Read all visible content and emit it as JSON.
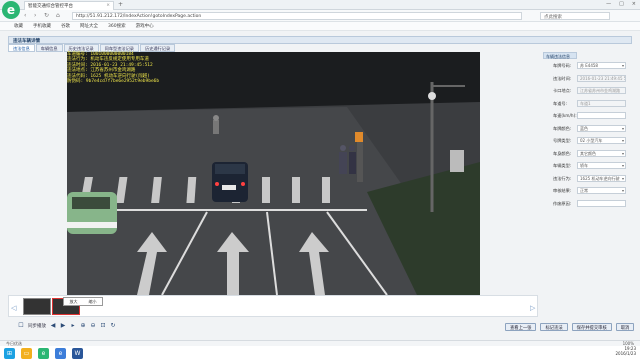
{
  "browser": {
    "tab_title": "智能交通综合管控平台",
    "url": "http://51.91.212.172/IndexAction!gotoIndexPage.action",
    "search_placeholder": "点此搜索",
    "favorites": [
      "收藏",
      "手机收藏",
      "谷歌",
      "网址大全",
      "360搜索",
      "游戏中心"
    ]
  },
  "panel": {
    "title": "违法车辆详情",
    "subtabs": [
      "违法信息",
      "车辆信息",
      "历史违法记录",
      "同车型违法记录",
      "历史通行记录"
    ]
  },
  "overlay_text": [
    "车道编号: 1001000000000184",
    "违法行为: 机动车违反规定使用专用车道",
    "违法时间: 2016-01-23 21:49:45:512",
    "违法地点: 江苏省苏州市金鸡湖路",
    "违法代码: 1625 机动车逆向行驶(闯越)",
    "防伪码: 9b7e4cd7f7be6e2952t9eb9be6b"
  ],
  "side": {
    "header": "车辆违法信息",
    "fields": [
      {
        "label": "车牌号码:",
        "value": "苏 E4458",
        "disabled": false,
        "dropdown": true
      },
      {
        "label": "违法时间:",
        "value": "2016-01-23 21:49:45 573",
        "disabled": true,
        "dropdown": false
      },
      {
        "label": "卡口地点:",
        "value": "江苏省苏州市金鸡湖路",
        "disabled": true,
        "dropdown": false
      },
      {
        "label": "车道号:",
        "value": "车道1",
        "disabled": true,
        "dropdown": false
      },
      {
        "label": "车速(km/h):",
        "value": "",
        "disabled": false,
        "dropdown": false
      },
      {
        "label": "车牌颜色:",
        "value": "蓝色",
        "disabled": false,
        "dropdown": true
      },
      {
        "label": "号牌类型:",
        "value": "02 小型汽车",
        "disabled": false,
        "dropdown": true
      },
      {
        "label": "车身颜色:",
        "value": "其它颜色",
        "disabled": false,
        "dropdown": true
      },
      {
        "label": "车辆类型:",
        "value": "轿车",
        "disabled": false,
        "dropdown": true
      },
      {
        "label": "违法行为:",
        "value": "1625 机动车逆向行驶",
        "disabled": false,
        "dropdown": true
      },
      {
        "label": "审核结果:",
        "value": "正常",
        "disabled": false,
        "dropdown": true
      },
      {
        "label": "作废原因:",
        "value": "",
        "disabled": false,
        "dropdown": false
      }
    ]
  },
  "thumbs_menu": [
    "放大",
    "缩小"
  ],
  "toolbar": {
    "sync_label": "同步播放"
  },
  "actions": [
    "查看上一张",
    "标记违法",
    "保存并提交审核",
    "取消"
  ],
  "statusbar": {
    "left": "今日优选",
    "right": "100%"
  },
  "clock": {
    "time": "19:23",
    "date": "2016/1/23"
  }
}
